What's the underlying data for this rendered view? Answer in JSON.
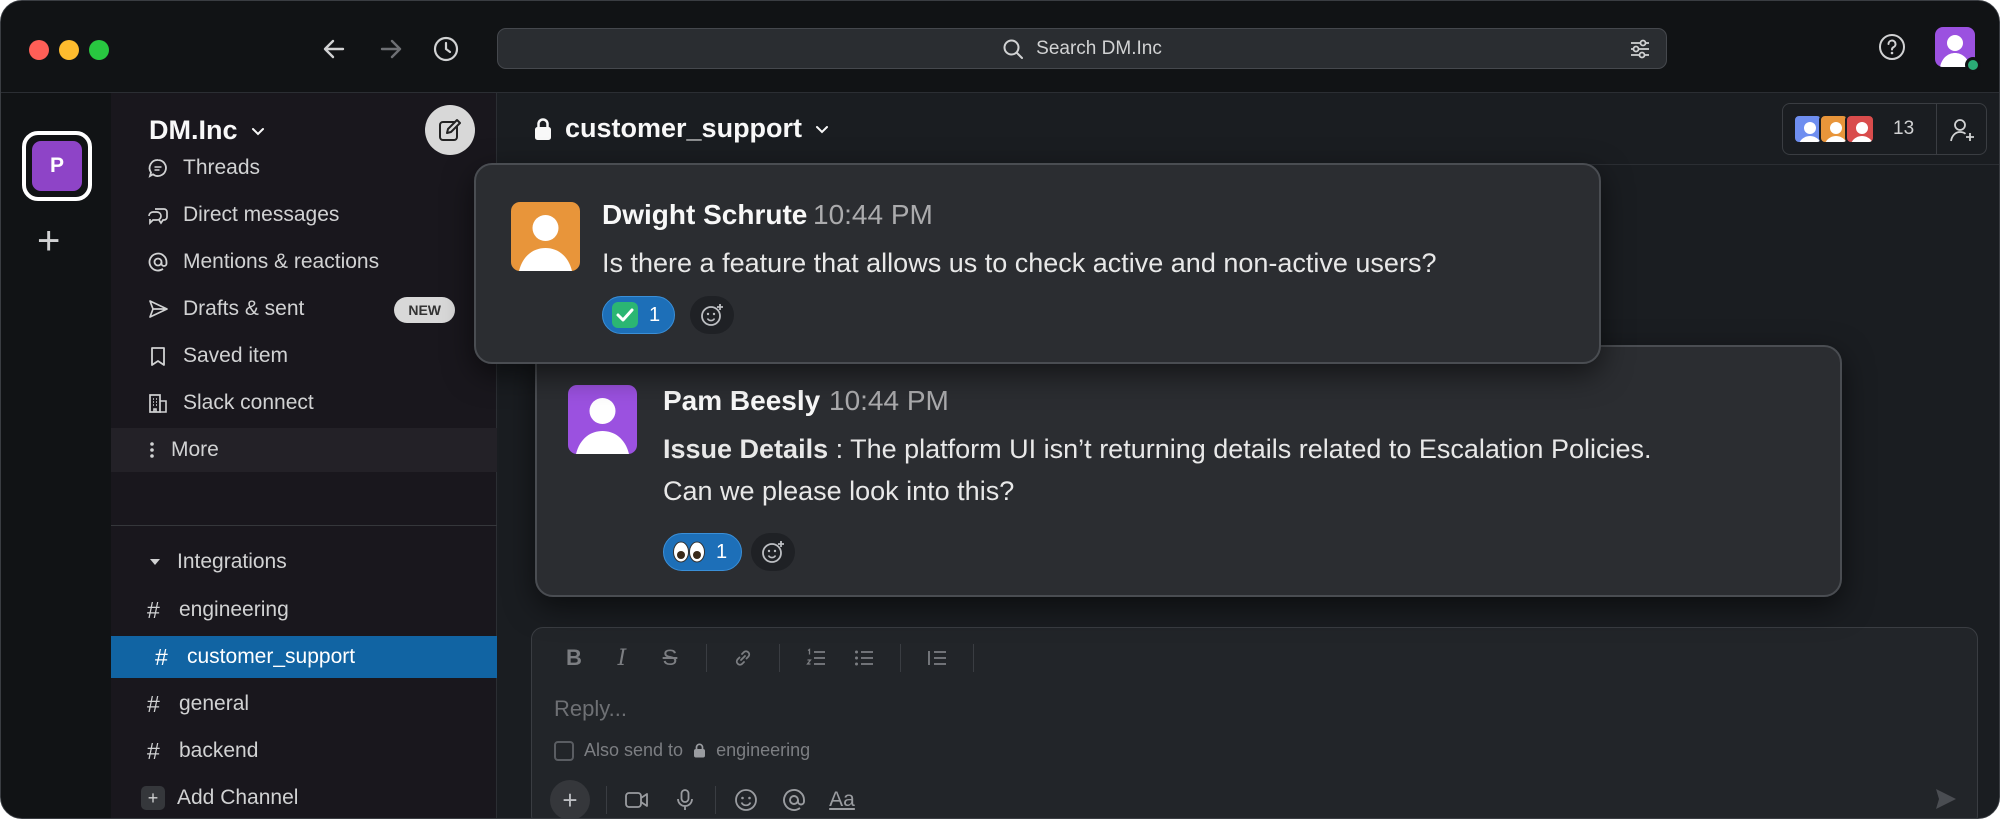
{
  "window": {
    "title": "DM.Inc"
  },
  "search": {
    "label": "Search DM.Inc"
  },
  "workspace": {
    "initial": "P",
    "name": "DM.Inc"
  },
  "sidebar": {
    "items": [
      {
        "label": "Threads",
        "icon": "threads-icon"
      },
      {
        "label": "Direct messages",
        "icon": "direct-messages-icon"
      },
      {
        "label": "Mentions & reactions",
        "icon": "at-icon"
      },
      {
        "label": "Drafts & sent",
        "icon": "send-icon",
        "badge": "NEW"
      },
      {
        "label": "Saved item",
        "icon": "bookmark-icon"
      },
      {
        "label": "Slack connect",
        "icon": "building-icon"
      },
      {
        "label": "More",
        "icon": "more-icon"
      }
    ],
    "section": {
      "label": "Integrations"
    },
    "channels": [
      {
        "label": "engineering"
      },
      {
        "label": "customer_support"
      },
      {
        "label": "general"
      },
      {
        "label": "backend"
      }
    ],
    "add_channel": "Add Channel"
  },
  "channel_header": {
    "name": "customer_support",
    "member_count": "13"
  },
  "messages": [
    {
      "author": "Dwight Schrute",
      "time": "10:44 PM",
      "text": "Is there a feature that allows us to check active and non-active users?",
      "reaction": {
        "emoji": "check-mark",
        "count": "1"
      }
    },
    {
      "author": "Pam Beesly",
      "time": "10:44 PM",
      "label": "Issue Details",
      "text_line1": " : The platform UI isn’t returning details related to Escalation Policies.",
      "text_line2": "Can we please look into this?",
      "reaction": {
        "emoji": "eyes",
        "count": "1"
      }
    }
  ],
  "composer": {
    "placeholder": "Reply...",
    "also_send": "Also send to",
    "also_send_channel": "engineering",
    "format_label": "Aa"
  },
  "colors": {
    "accent": "#1164a3",
    "workspace": "#8e44c7",
    "presence": "#2bac76",
    "dwight_avatar": "#e8953a",
    "pam_avatar": "#9b51e0"
  }
}
